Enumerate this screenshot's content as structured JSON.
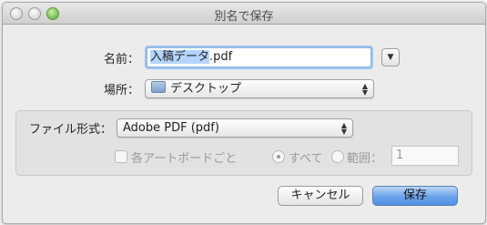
{
  "window": {
    "title": "別名で保存"
  },
  "name": {
    "label": "名前：",
    "value_selected": "入稿データ",
    "value_rest": ".pdf"
  },
  "location": {
    "label": "場所：",
    "value": "デスクトップ"
  },
  "format": {
    "label": "ファイル形式：",
    "value": "Adobe PDF (pdf)"
  },
  "options": {
    "artboards_label": "各アートボードごと",
    "all_label": "すべて",
    "range_label": "範囲：",
    "range_value": "1"
  },
  "buttons": {
    "cancel": "キャンセル",
    "save": "保存"
  },
  "icons": {
    "expand": "expand-chevron-icon",
    "folder": "folder-icon"
  }
}
